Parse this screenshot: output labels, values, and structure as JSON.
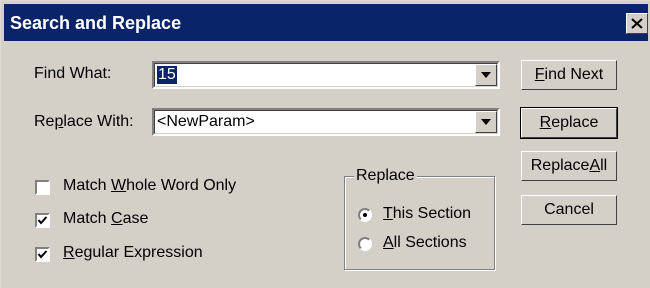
{
  "dialog": {
    "title": "Search and Replace"
  },
  "find": {
    "label_pre": "Find What:",
    "value": "15"
  },
  "replace": {
    "label_pre": "Re",
    "label_key": "p",
    "label_post": "lace With:",
    "value": "<NewParam>"
  },
  "buttons": {
    "find_next_key": "F",
    "find_next_rest": "ind Next",
    "replace_key": "R",
    "replace_rest": "eplace",
    "replace_all_pre": "Replace ",
    "replace_all_key": "A",
    "replace_all_rest": "ll",
    "cancel": "Cancel"
  },
  "options": {
    "whole_word_pre": "Match ",
    "whole_word_key": "W",
    "whole_word_rest": "hole Word Only",
    "whole_word_checked": false,
    "match_case_pre": "Match ",
    "match_case_key": "C",
    "match_case_rest": "ase",
    "match_case_checked": true,
    "regex_key": "R",
    "regex_rest": "egular Expression",
    "regex_checked": true
  },
  "scope": {
    "legend": "Replace",
    "this_section_key": "T",
    "this_section_rest": "his Section",
    "all_sections_key": "A",
    "all_sections_rest": "ll Sections",
    "selected": "this_section"
  }
}
